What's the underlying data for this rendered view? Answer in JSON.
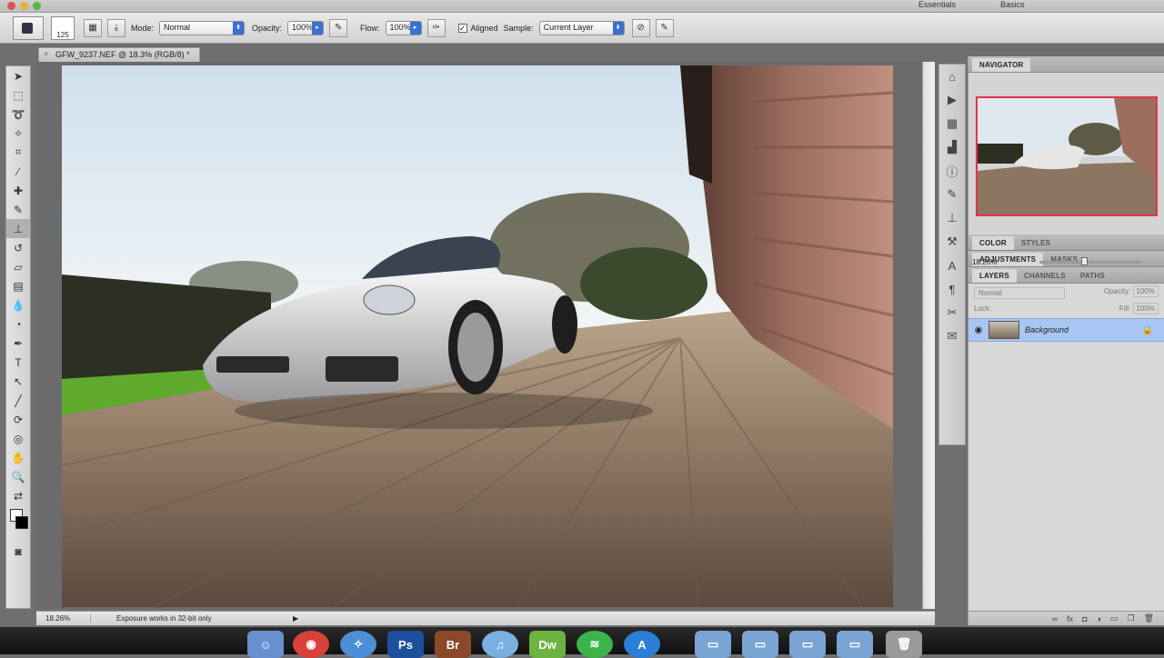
{
  "menu_strip": {
    "right_items": [
      "Essentials",
      "Basics"
    ]
  },
  "options_bar": {
    "brush_size": "125",
    "mode_label": "Mode:",
    "mode_value": "Normal",
    "opacity_label": "Opacity:",
    "opacity_value": "100%",
    "flow_label": "Flow:",
    "flow_value": "100%",
    "aligned_label": "Aligned",
    "sample_label": "Sample:",
    "sample_value": "Current Layer"
  },
  "document": {
    "tab_title": "GFW_9237.NEF @ 18.3% (RGB/8) *"
  },
  "status_bar": {
    "zoom": "18.26%",
    "info": "Exposure works in 32-bit only",
    "play_icon": "▶"
  },
  "navigator": {
    "tab_label": "NAVIGATOR",
    "zoom": "18.26%"
  },
  "color_panel": {
    "tabs": [
      "COLOR",
      "STYLES"
    ]
  },
  "adjust_panel": {
    "tabs": [
      "ADJUSTMENTS",
      "MASKS"
    ]
  },
  "layers_panel": {
    "tabs": [
      "LAYERS",
      "CHANNELS",
      "PATHS"
    ],
    "blend_mode": "Normal",
    "opacity_label": "Opacity:",
    "opacity_value": "100%",
    "lock_label": "Lock:",
    "fill_label": "Fill:",
    "fill_value": "100%",
    "layer_name": "Background"
  },
  "dock": {
    "icons": [
      "finder-icon",
      "chrome-icon",
      "safari-icon",
      "photoshop-icon",
      "bridge-icon",
      "itunes-icon",
      "dreamweaver-icon",
      "spotify-icon",
      "appstore-icon"
    ]
  },
  "colors": {
    "panel_bg": "#d8d8d8",
    "selected_layer": "#a8c6f2",
    "navigator_box": "#e0344d",
    "photoshop_blue": "#1e4f9c"
  }
}
